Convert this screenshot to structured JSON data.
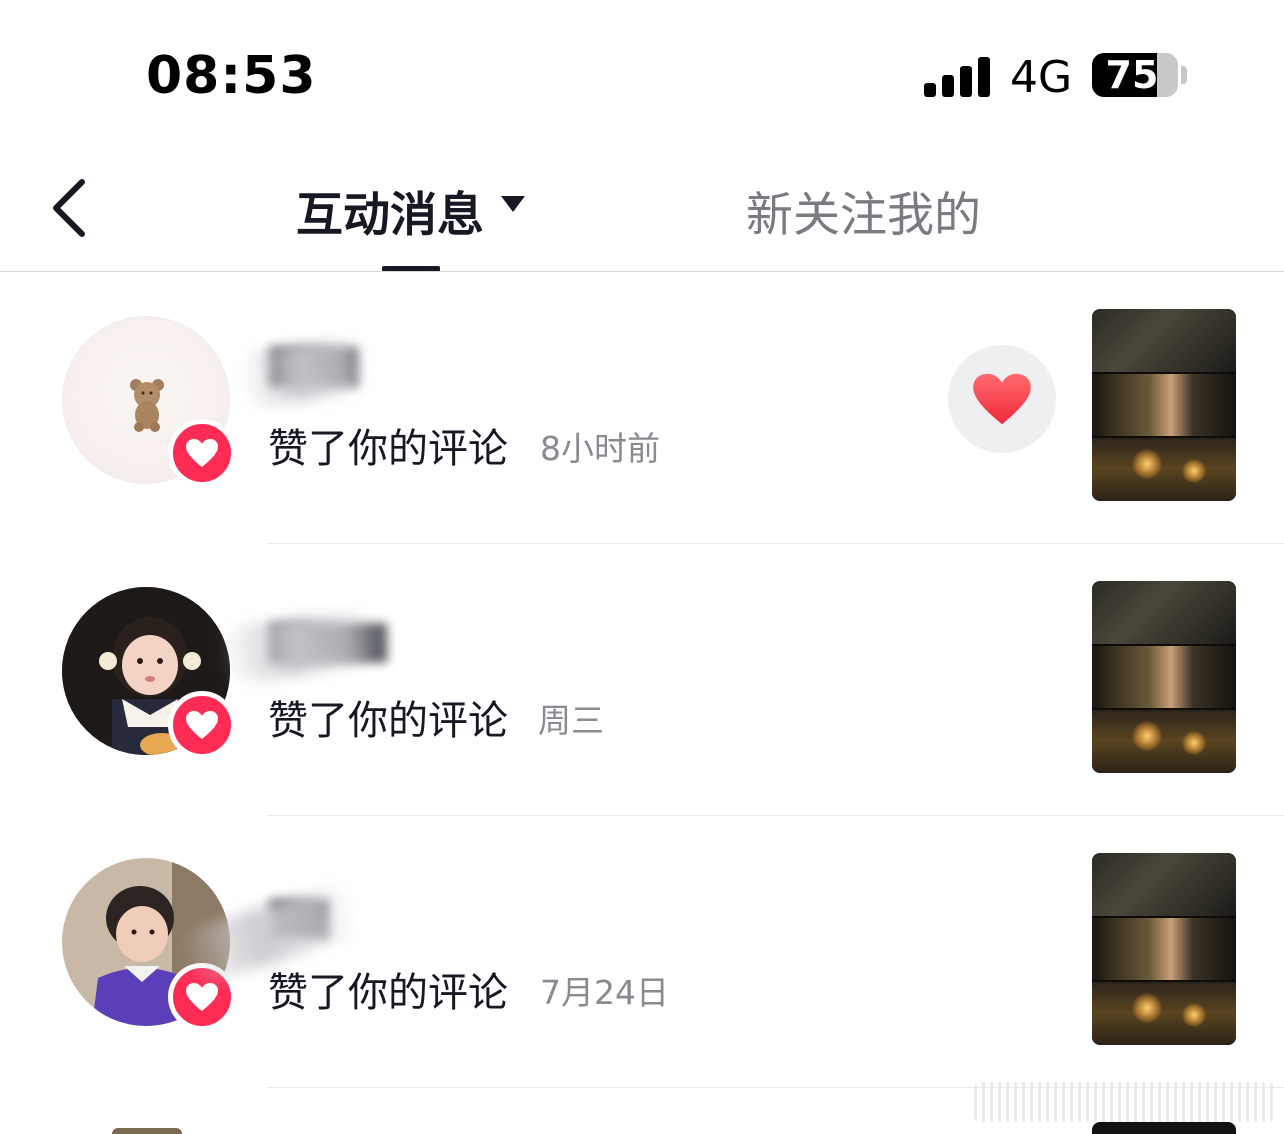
{
  "status_bar": {
    "time": "08:53",
    "network": "4G",
    "battery": "75",
    "battery_level": 0.75
  },
  "nav": {
    "back_icon": "chevron-left-icon",
    "tabs": [
      {
        "label": "互动消息",
        "active": true,
        "dropdown_icon": "caret-down-icon"
      },
      {
        "label": "新关注我的",
        "active": false
      }
    ]
  },
  "notifications": [
    {
      "action": "赞了你的评论",
      "time": "8小时前",
      "avatar_icon": "bear-avatar",
      "badge_icon": "heart-icon",
      "like_back_icon": "heart-icon",
      "username_obscured": true
    },
    {
      "action": "赞了你的评论",
      "time": "周三",
      "avatar_icon": "girl-avatar",
      "badge_icon": "heart-icon",
      "username_obscured": true
    },
    {
      "action": "赞了你的评论",
      "time": "7月24日",
      "avatar_icon": "boy-avatar",
      "badge_icon": "heart-icon",
      "username_obscured": true
    }
  ],
  "colors": {
    "accent": "#fe2c55",
    "text_primary": "#161823",
    "text_secondary": "#8a8b91",
    "tab_inactive": "#7a7b80"
  }
}
